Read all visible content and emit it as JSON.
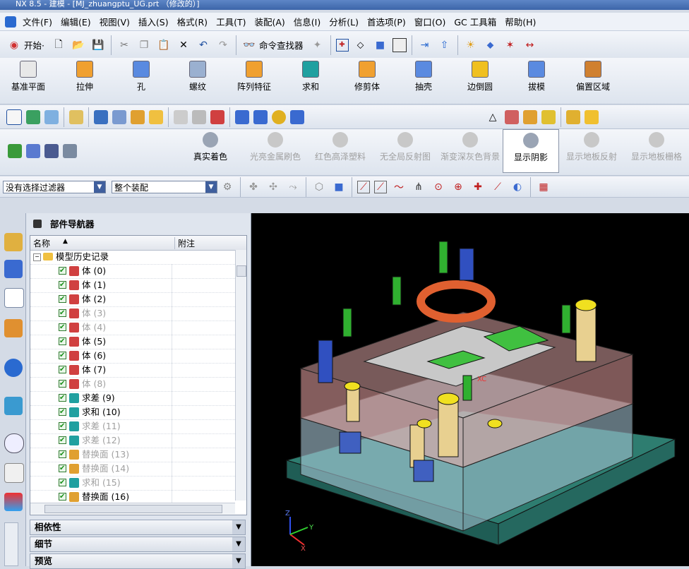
{
  "window": {
    "title": "NX 8.5 - 建模 - [MJ_zhuangptu_UG.prt （修改的）]"
  },
  "menu": [
    "文件(F)",
    "编辑(E)",
    "视图(V)",
    "插入(S)",
    "格式(R)",
    "工具(T)",
    "装配(A)",
    "信息(I)",
    "分析(L)",
    "首选项(P)",
    "窗口(O)",
    "GC 工具箱",
    "帮助(H)"
  ],
  "toolbar1": {
    "start_label": "开始·",
    "find_label": "命令查找器"
  },
  "feature_toolbar": [
    {
      "label": "基准平面",
      "color": "#e8e8e8"
    },
    {
      "label": "拉伸",
      "color": "#f0a030"
    },
    {
      "label": "孔",
      "color": "#5a8ae0"
    },
    {
      "label": "螺纹",
      "color": "#9ab0d0"
    },
    {
      "label": "阵列特征",
      "color": "#f0a030"
    },
    {
      "label": "求和",
      "color": "#20a0a0"
    },
    {
      "label": "修剪体",
      "color": "#f0a030"
    },
    {
      "label": "抽壳",
      "color": "#5a8ae0"
    },
    {
      "label": "边倒圆",
      "color": "#f0c020"
    },
    {
      "label": "拔模",
      "color": "#5a8ae0"
    },
    {
      "label": "偏置区域",
      "color": "#d08030"
    }
  ],
  "render_toolbar": [
    {
      "label": "真实着色",
      "enabled": true
    },
    {
      "label": "光亮金属刷色",
      "enabled": false
    },
    {
      "label": "红色高泽塑料",
      "enabled": false
    },
    {
      "label": "无全局反射图",
      "enabled": false
    },
    {
      "label": "渐变深灰色背景",
      "enabled": false
    },
    {
      "label": "显示阴影",
      "enabled": true
    },
    {
      "label": "显示地板反射",
      "enabled": false
    },
    {
      "label": "显示地板栅格",
      "enabled": false
    }
  ],
  "filters": {
    "selection_filter": "没有选择过滤器",
    "scope": "整个装配"
  },
  "navigator": {
    "title": "部件导航器",
    "col_name": "名称",
    "col_note": "附注",
    "root": "模型历史记录",
    "items": [
      {
        "label": "体 (0)",
        "gray": false
      },
      {
        "label": "体 (1)",
        "gray": false
      },
      {
        "label": "体 (2)",
        "gray": false
      },
      {
        "label": "体 (3)",
        "gray": true
      },
      {
        "label": "体 (4)",
        "gray": true
      },
      {
        "label": "体 (5)",
        "gray": false
      },
      {
        "label": "体 (6)",
        "gray": false
      },
      {
        "label": "体 (7)",
        "gray": false
      },
      {
        "label": "体 (8)",
        "gray": true
      },
      {
        "label": "求差 (9)",
        "gray": false
      },
      {
        "label": "求和 (10)",
        "gray": false
      },
      {
        "label": "求差 (11)",
        "gray": true
      },
      {
        "label": "求差 (12)",
        "gray": true
      },
      {
        "label": "替换面 (13)",
        "gray": true
      },
      {
        "label": "替换面 (14)",
        "gray": true
      },
      {
        "label": "求和 (15)",
        "gray": true
      },
      {
        "label": "替换面 (16)",
        "gray": false
      }
    ],
    "panels": [
      "相依性",
      "细节",
      "预览"
    ]
  },
  "viewport": {
    "axis_x": "X",
    "axis_y": "Y",
    "axis_z": "Z",
    "wcs_label": "XC"
  }
}
